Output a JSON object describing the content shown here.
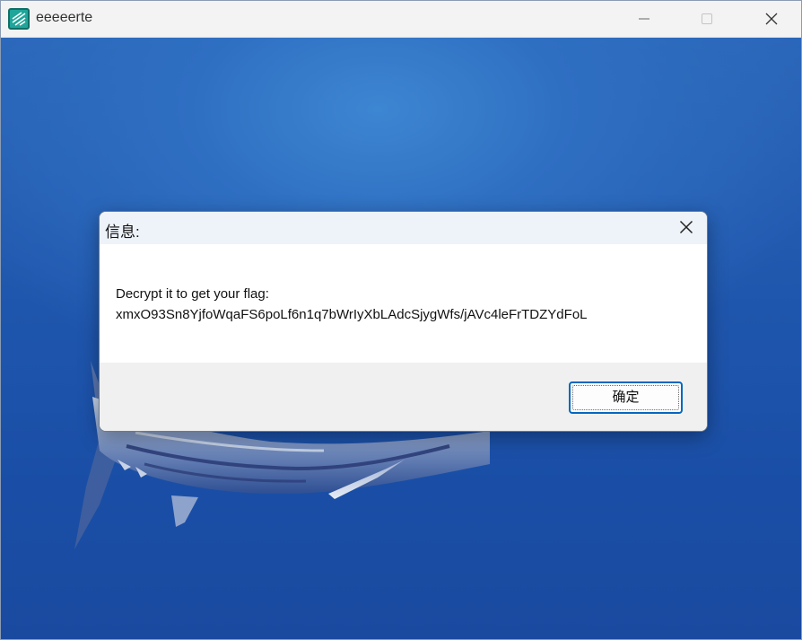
{
  "window": {
    "title": "eeeeerte",
    "icon": "app-logo-icon",
    "controls": {
      "minimize": "minimize-icon",
      "maximize": "maximize-icon",
      "close": "close-icon"
    }
  },
  "dialog": {
    "title": "信息:",
    "message_line1": "Decrypt it to get your flag:",
    "message_line2": "xmxO93Sn8YjfoWqaFS6poLf6n1q7bWrIyXbLAdcSjygWfs/jAVc4leFrTDZYdFoL",
    "ok_label": "确定",
    "close_icon": "close-icon"
  },
  "colors": {
    "accent": "#0067c0",
    "background_water": "#1f56ad",
    "icon_teal": "#1fa59a"
  }
}
